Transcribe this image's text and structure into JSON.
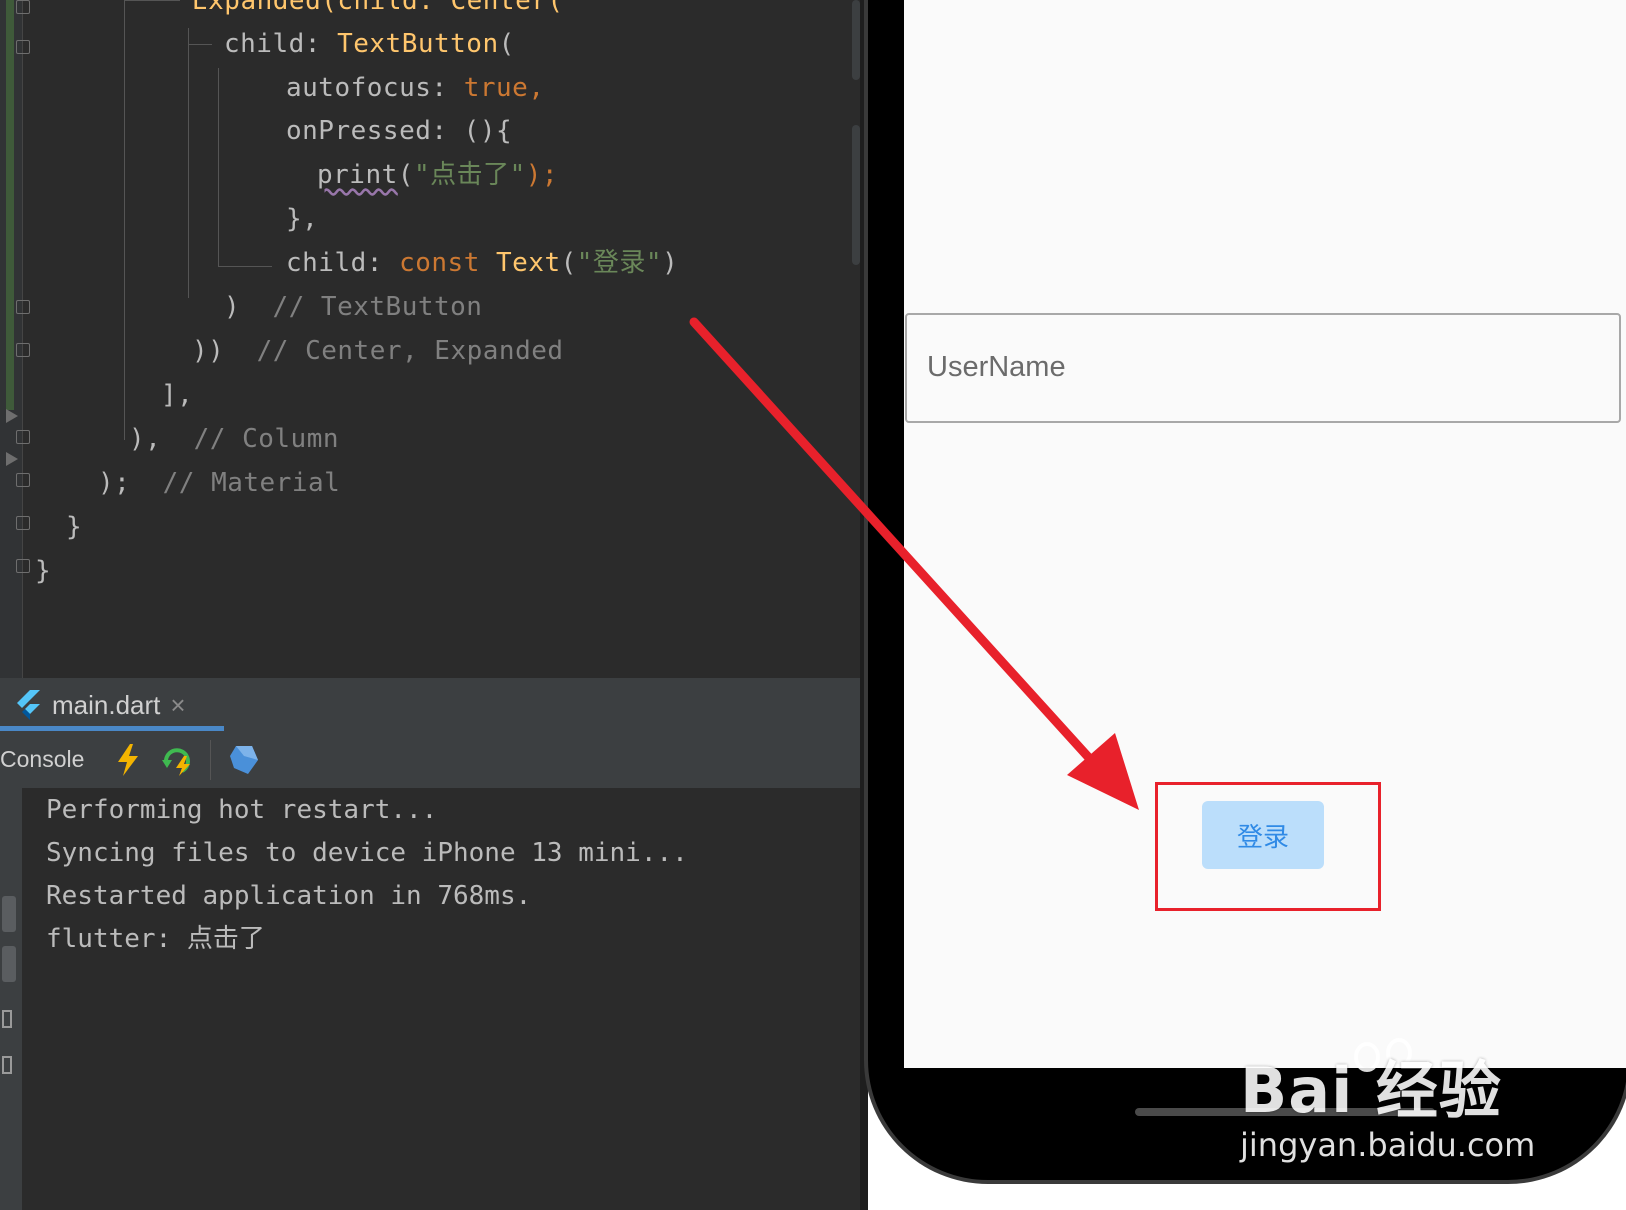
{
  "editor": {
    "code_lines": [
      {
        "indent": "",
        "parts": [
          {
            "t": "Expanded(child: Center(",
            "c": "cls"
          }
        ]
      },
      {
        "indent": "",
        "parts": [
          {
            "t": "child: ",
            "c": ""
          },
          {
            "t": "TextButton",
            "c": "cls"
          },
          {
            "t": "(",
            "c": ""
          }
        ]
      },
      {
        "indent": "",
        "parts": [
          {
            "t": "autofocus: ",
            "c": ""
          },
          {
            "t": "true",
            "c": "kw"
          },
          {
            "t": ",",
            "c": "kw"
          }
        ]
      },
      {
        "indent": "",
        "parts": [
          {
            "t": "onPressed: (){",
            "c": ""
          }
        ]
      },
      {
        "indent": "",
        "parts": [
          {
            "t": "print",
            "c": "wavy"
          },
          {
            "t": "(",
            "c": ""
          },
          {
            "t": "\"点击了\"",
            "c": "str"
          },
          {
            "t": ");",
            "c": "kw"
          }
        ]
      },
      {
        "indent": "",
        "parts": [
          {
            "t": "},",
            "c": ""
          }
        ]
      },
      {
        "indent": "",
        "parts": [
          {
            "t": "child: ",
            "c": ""
          },
          {
            "t": "const ",
            "c": "kw"
          },
          {
            "t": "Text",
            "c": "cls"
          },
          {
            "t": "(",
            "c": ""
          },
          {
            "t": "\"登录\"",
            "c": "str"
          },
          {
            "t": ")",
            "c": ""
          }
        ]
      },
      {
        "indent": "",
        "parts": [
          {
            "t": ")  ",
            "c": ""
          },
          {
            "t": "// TextButton",
            "c": "cm"
          }
        ]
      },
      {
        "indent": "",
        "parts": [
          {
            "t": "))  ",
            "c": ""
          },
          {
            "t": "// Center, Expanded",
            "c": "cm"
          }
        ]
      },
      {
        "indent": "",
        "parts": [
          {
            "t": "],",
            "c": ""
          }
        ]
      },
      {
        "indent": "",
        "parts": [
          {
            "t": "),  ",
            "c": ""
          },
          {
            "t": "// Column",
            "c": "cm"
          }
        ]
      },
      {
        "indent": "",
        "parts": [
          {
            "t": ");  ",
            "c": ""
          },
          {
            "t": "// Material",
            "c": "cm"
          }
        ]
      },
      {
        "indent": "",
        "parts": [
          {
            "t": "}",
            "c": ""
          }
        ]
      },
      {
        "indent": "",
        "parts": [
          {
            "t": "}",
            "c": ""
          }
        ]
      }
    ]
  },
  "tab": {
    "label": "main.dart",
    "close": "×"
  },
  "toolbar": {
    "label": "Console"
  },
  "console": {
    "lines": [
      "Performing hot restart...",
      "Syncing files to device iPhone 13 mini...",
      "Restarted application in 768ms.",
      "flutter: 点击了"
    ]
  },
  "app": {
    "username_placeholder": "UserName",
    "login_label": "登录"
  },
  "watermark": {
    "brand": "Bai  经验",
    "url": "jingyan.baidu.com"
  },
  "colors": {
    "keyword": "#cc7832",
    "class": "#ffc66d",
    "string": "#6a8759",
    "comment": "#808080",
    "highlight": "#e8212b",
    "button_bg": "#bbdefb",
    "button_text": "#2f8ae6"
  }
}
